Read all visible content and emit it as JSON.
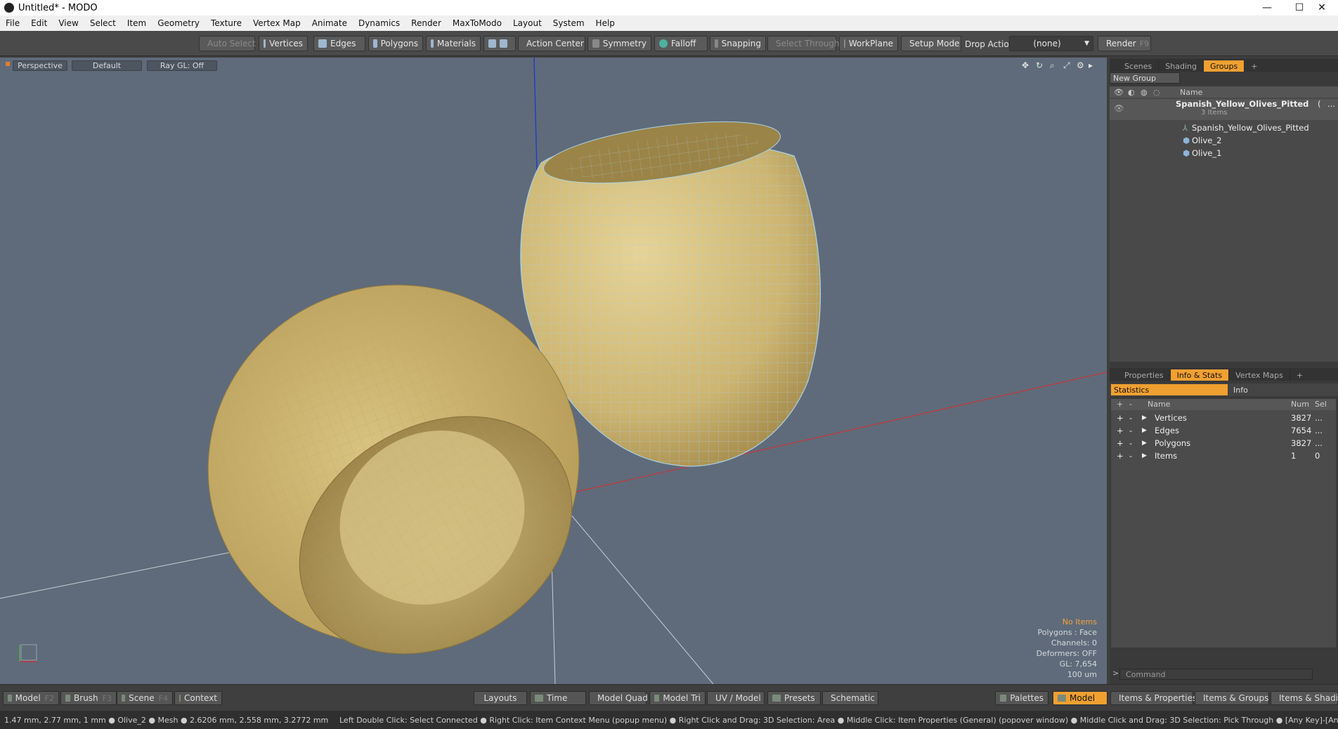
{
  "window": {
    "title": "Untitled* - MODO",
    "minimize": "—",
    "maximize": "☐",
    "close": "✕"
  },
  "menu": [
    "File",
    "Edit",
    "View",
    "Select",
    "Item",
    "Geometry",
    "Texture",
    "Vertex Map",
    "Animate",
    "Dynamics",
    "Render",
    "MaxToModo",
    "Layout",
    "System",
    "Help"
  ],
  "toolbar": {
    "auto_select": "Auto Select",
    "vertices": "Vertices",
    "edges": "Edges",
    "polygons": "Polygons",
    "materials": "Materials",
    "action_center": "Action Center",
    "symmetry": "Symmetry",
    "falloff": "Falloff",
    "snapping": "Snapping",
    "select_through": "Select Through",
    "workplane": "WorkPlane",
    "setup_mode": "Setup Mode",
    "drop_action_label": "Drop Action",
    "drop_action_value": "(none)",
    "render": "Render",
    "render_key": "F9"
  },
  "viewport": {
    "view": "Perspective",
    "style": "Default",
    "raygl": "Ray GL: Off",
    "hud": {
      "no_items": "No Items",
      "polygons": "Polygons : Face",
      "channels": "Channels: 0",
      "deformers": "Deformers: OFF",
      "gl": "GL: 7,654",
      "scale": "100 um"
    },
    "colors": {
      "background": "#5f6b7a",
      "olive": "#d8c17a",
      "wire": "#a9d3e6",
      "axis_x": "#c8353a",
      "axis_y": "#2a36c8"
    }
  },
  "groups_panel": {
    "tabs": [
      "Scenes",
      "Shading",
      "Groups"
    ],
    "active_tab": "Groups",
    "new_group": "New Group",
    "col_name": "Name",
    "root": {
      "name": "Spanish_Yellow_Olives_Pitted",
      "suffix": "(",
      "count": "3 Items",
      "more": "..."
    },
    "children": [
      "Spanish_Yellow_Olives_Pitted",
      "Olive_2",
      "Olive_1"
    ]
  },
  "stats_panel": {
    "tabs": [
      "Properties",
      "Info & Stats",
      "Vertex Maps"
    ],
    "active_tab": "Info & Stats",
    "sub_tabs": [
      "Statistics",
      "Info"
    ],
    "columns": [
      "Name",
      "Num",
      "Sel"
    ],
    "rows": [
      {
        "name": "Vertices",
        "num": "3827",
        "sel": "..."
      },
      {
        "name": "Edges",
        "num": "7654",
        "sel": "..."
      },
      {
        "name": "Polygons",
        "num": "3827",
        "sel": "..."
      },
      {
        "name": "Items",
        "num": "1",
        "sel": "0"
      }
    ],
    "command_placeholder": "Command"
  },
  "bottom_bar": {
    "model": "Model",
    "model_key": "F2",
    "brush": "Brush",
    "brush_key": "F3",
    "scene": "Scene",
    "scene_key": "F4",
    "context": "Context",
    "layouts": "Layouts",
    "time": "Time",
    "model_quad": "Model Quad",
    "model_tri": "Model Tri",
    "uv_model": "UV / Model",
    "presets": "Presets",
    "schematic": "Schematic",
    "palettes": "Palettes",
    "model_active": "Model",
    "items_properties": "Items & Properties",
    "items_groups": "Items & Groups",
    "items_shading": "Items & Shading"
  },
  "status_bar": {
    "left": "1.47 mm, 2.77 mm, 1 mm ● Olive_2 ● Mesh ● 2.6206 mm, 2.558 mm, 3.2772 mm",
    "right": "Left Double Click: Select Connected ● Right Click: Item Context Menu (popup menu) ● Right Click and Drag: 3D Selection: Area ● Middle Click: Item Properties (General) (popover window) ● Middle Click and Drag: 3D Selection: Pick Through ● [Any Key]-[Any Button] Click and Drag: dragDropB"
  }
}
